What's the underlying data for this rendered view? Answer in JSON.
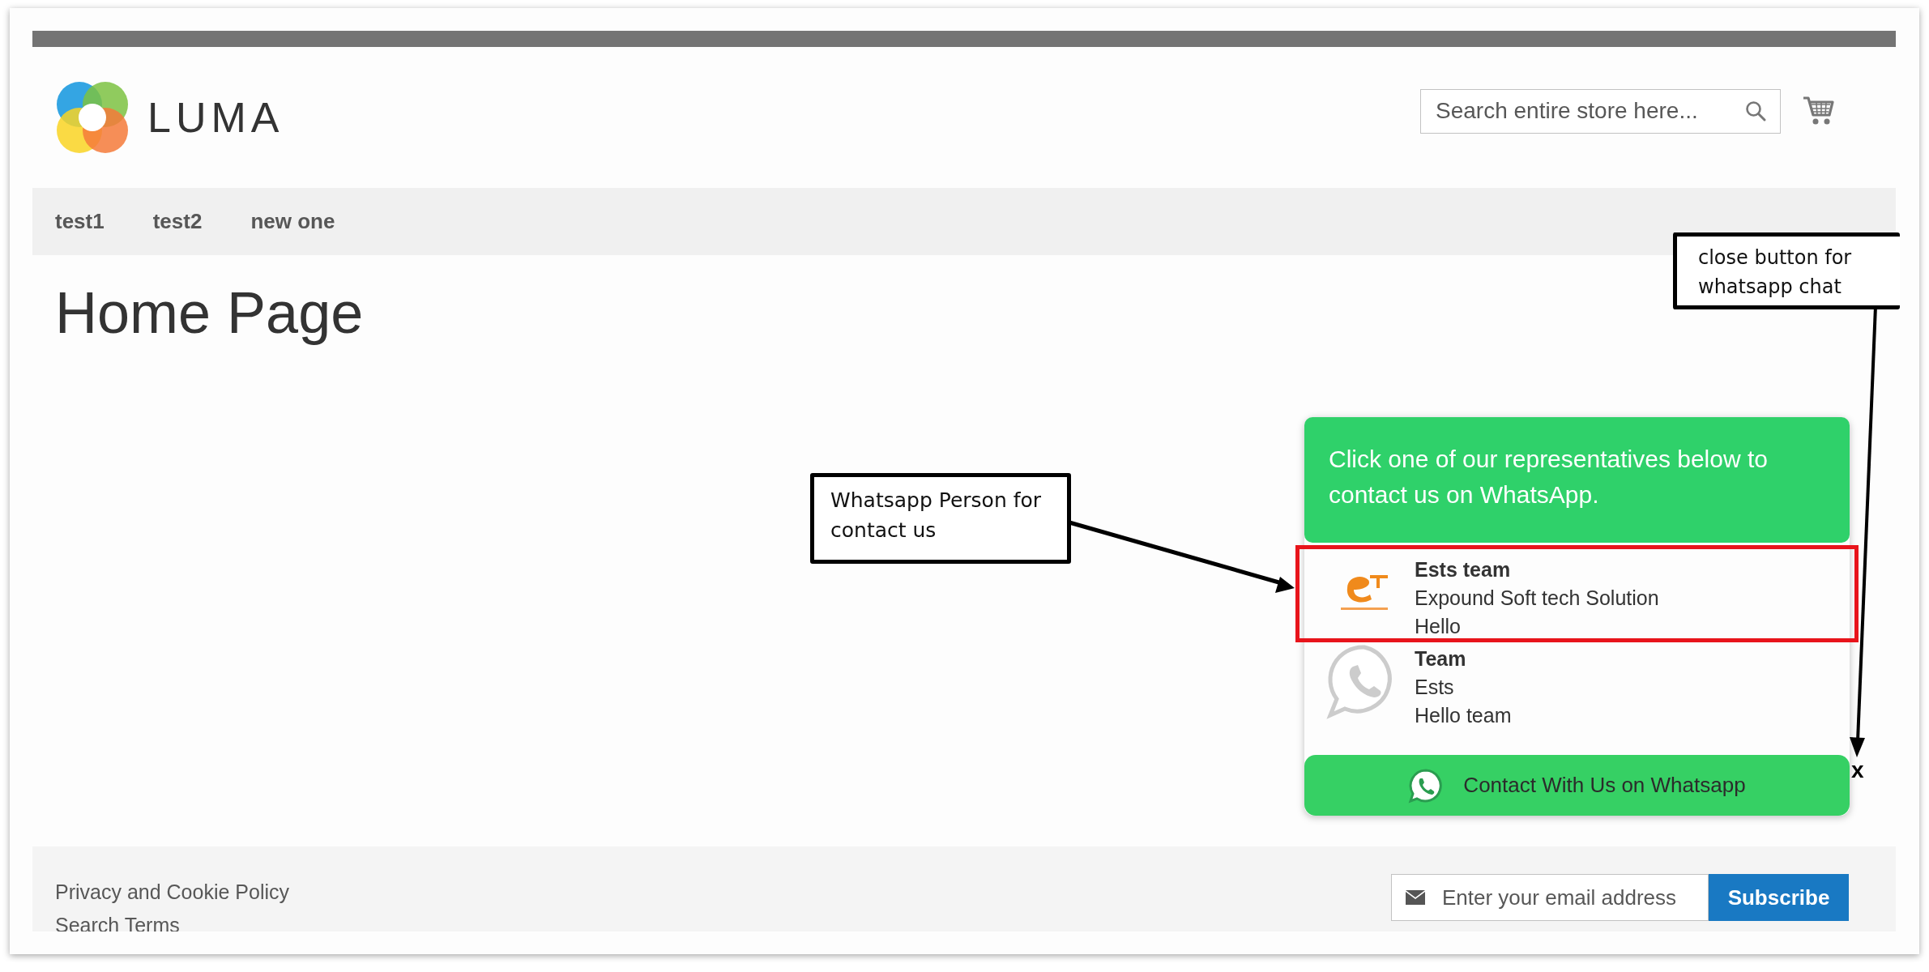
{
  "header": {
    "logo_text": "LUMA",
    "search": {
      "placeholder": "Search entire store here..."
    }
  },
  "nav": {
    "items": [
      {
        "label": "test1"
      },
      {
        "label": "test2"
      },
      {
        "label": "new one"
      }
    ]
  },
  "page_title": "Home Page",
  "whatsapp_widget": {
    "intro": "Click one of our representatives below to contact us on WhatsApp.",
    "agents": [
      {
        "name": "Ests team",
        "company": "Expound Soft tech Solution",
        "message": "Hello",
        "kind": "logo",
        "highlighted": true
      },
      {
        "name": "Team",
        "company": "Ests",
        "message": "Hello team",
        "kind": "whatsapp",
        "highlighted": false
      }
    ],
    "contact_button": "Contact With Us on Whatsapp",
    "close": "x"
  },
  "footer": {
    "links": [
      "Privacy and Cookie Policy",
      "Search Terms"
    ],
    "newsletter": {
      "placeholder": "Enter your email address",
      "button": "Subscribe"
    }
  },
  "annotations": [
    {
      "text": "Whatsapp Person for contact us",
      "kind": "person"
    },
    {
      "text": "close button for whatsapp chat",
      "kind": "close"
    }
  ]
}
